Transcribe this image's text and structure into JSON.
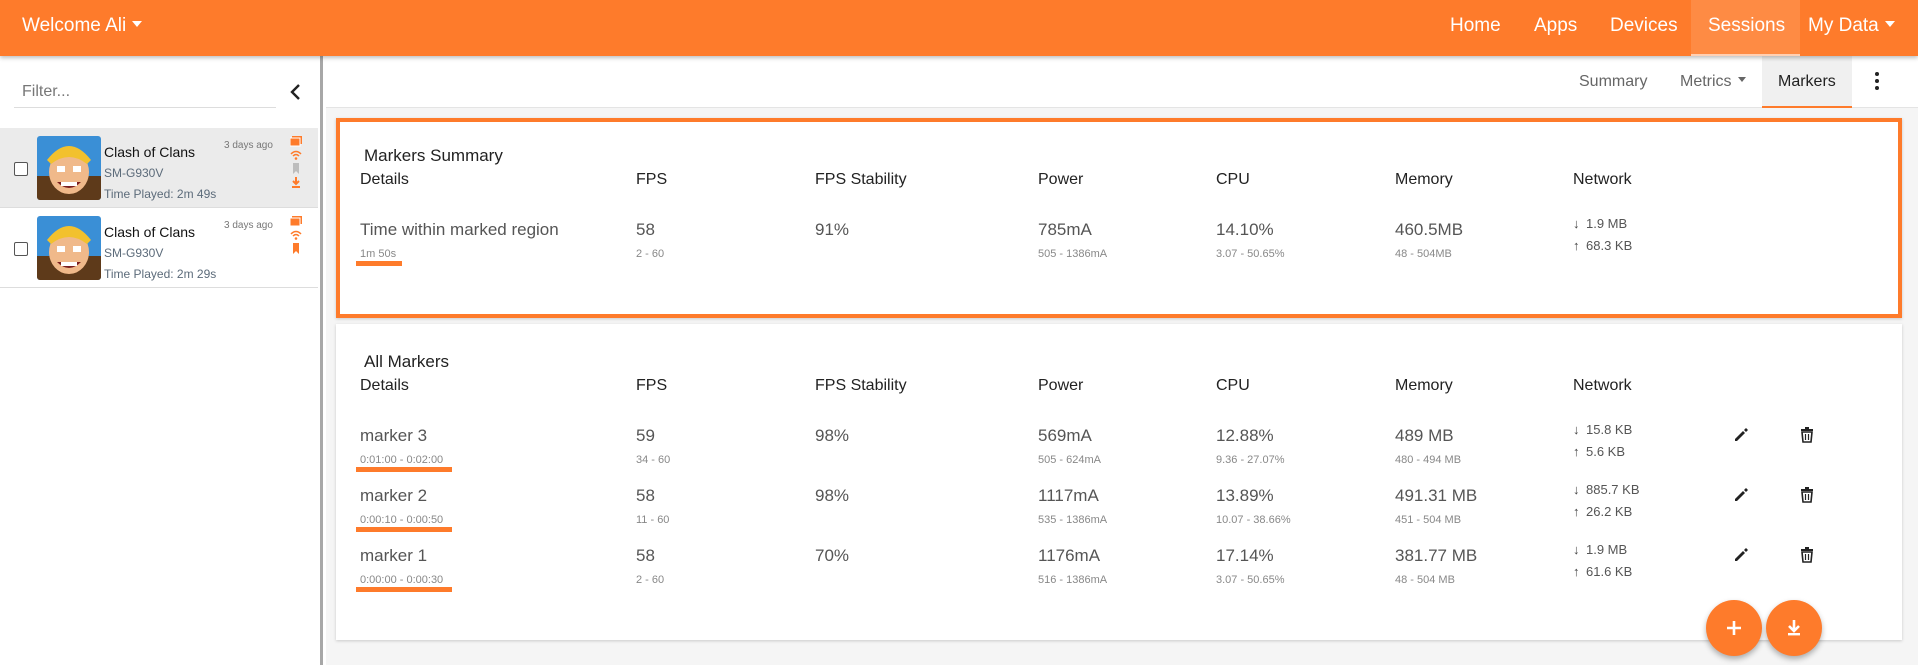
{
  "navbar": {
    "brand": "Welcome Ali",
    "items": [
      "Home",
      "Apps",
      "Devices",
      "Sessions",
      "My Data"
    ],
    "active": "Sessions",
    "accent": "#fe7b2b"
  },
  "sidebar": {
    "filter_placeholder": "Filter...",
    "sessions": [
      {
        "title": "Clash of Clans",
        "device": "SM-G930V",
        "time_played": "Time Played: 2m 49s",
        "ago": "3 days ago"
      },
      {
        "title": "Clash of Clans",
        "device": "SM-G930V",
        "time_played": "Time Played: 2m 29s",
        "ago": "3 days ago"
      }
    ]
  },
  "tabs": {
    "summary": "Summary",
    "metrics": "Metrics",
    "markers": "Markers",
    "active": "Markers"
  },
  "columns": [
    "Details",
    "FPS",
    "FPS Stability",
    "Power",
    "CPU",
    "Memory",
    "Network"
  ],
  "markers_summary": {
    "title": "Markers Summary",
    "row": {
      "name": "Time within marked region",
      "range": "1m 50s",
      "fps": "58",
      "fps_range": "2 - 60",
      "stability": "91%",
      "power": "785mA",
      "power_range": "505 - 1386mA",
      "cpu": "14.10%",
      "cpu_range": "3.07 - 50.65%",
      "memory": "460.5MB",
      "memory_range": "48 - 504MB",
      "net_down": "1.9 MB",
      "net_up": "68.3 KB"
    }
  },
  "all_markers": {
    "title": "All Markers",
    "rows": [
      {
        "name": "marker 3",
        "range": "0:01:00 - 0:02:00",
        "fps": "59",
        "fps_range": "34 - 60",
        "stability": "98%",
        "power": "569mA",
        "power_range": "505 - 624mA",
        "cpu": "12.88%",
        "cpu_range": "9.36 - 27.07%",
        "memory": "489 MB",
        "memory_range": "480 - 494 MB",
        "net_down": "15.8 KB",
        "net_up": "5.6 KB"
      },
      {
        "name": "marker 2",
        "range": "0:00:10 - 0:00:50",
        "fps": "58",
        "fps_range": "11 - 60",
        "stability": "98%",
        "power": "1117mA",
        "power_range": "535 - 1386mA",
        "cpu": "13.89%",
        "cpu_range": "10.07 - 38.66%",
        "memory": "491.31 MB",
        "memory_range": "451 - 504 MB",
        "net_down": "885.7 KB",
        "net_up": "26.2 KB"
      },
      {
        "name": "marker 1",
        "range": "0:00:00 - 0:00:30",
        "fps": "58",
        "fps_range": "2 - 60",
        "stability": "70%",
        "power": "1176mA",
        "power_range": "516 - 1386mA",
        "cpu": "17.14%",
        "cpu_range": "3.07 - 50.65%",
        "memory": "381.77 MB",
        "memory_range": "48 - 504 MB",
        "net_down": "1.9 MB",
        "net_up": "61.6 KB"
      }
    ]
  },
  "icons": {
    "fab_add": "plus-icon",
    "fab_download": "download-icon",
    "row_edit": "pencil-icon",
    "row_delete": "trash-icon"
  }
}
